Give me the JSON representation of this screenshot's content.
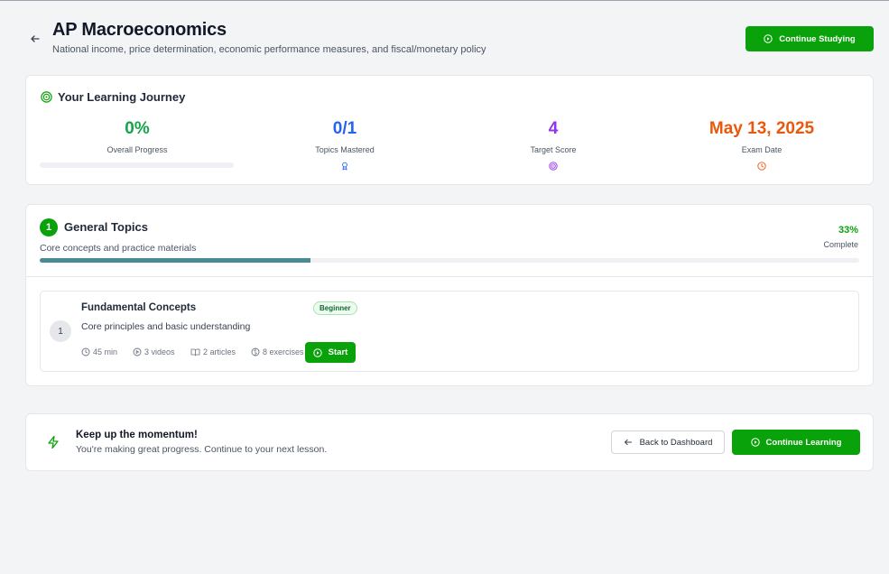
{
  "header": {
    "title": "AP Macroeconomics",
    "subtitle": "National income, price determination, economic performance measures, and fiscal/monetary policy",
    "continue_button": "Continue Studying"
  },
  "journey": {
    "title": "Your Learning Journey",
    "stats": [
      {
        "value": "0%",
        "label": "Overall Progress",
        "color": "#16a34a"
      },
      {
        "value": "0/1",
        "label": "Topics Mastered",
        "color": "#2563eb",
        "icon": "award-icon"
      },
      {
        "value": "4",
        "label": "Target Score",
        "color": "#9333ea",
        "icon": "target-icon"
      },
      {
        "value": "May 13, 2025",
        "label": "Exam Date",
        "color": "#ea580c",
        "icon": "clock-icon"
      }
    ],
    "overall_progress_fraction": 0
  },
  "topics": {
    "number": "1",
    "title": "General Topics",
    "subtitle": "Core concepts and practice materials",
    "percent": "33%",
    "percent_label": "Complete",
    "progress_fraction": 0.33,
    "lesson": {
      "number": "1",
      "title": "Fundamental Concepts",
      "level": "Beginner",
      "description": "Core principles and basic understanding",
      "duration": "45 min",
      "videos": "3 videos",
      "articles": "2 articles",
      "exercises": "8 exercises",
      "start_label": "Start"
    }
  },
  "momentum": {
    "title": "Keep up the momentum!",
    "subtitle": "You're making great progress. Continue to your next lesson.",
    "back_label": "Back to Dashboard",
    "continue_label": "Continue Learning"
  },
  "colors": {
    "accent_green": "#0aa20a",
    "progress_teal": "#4a8b93"
  }
}
